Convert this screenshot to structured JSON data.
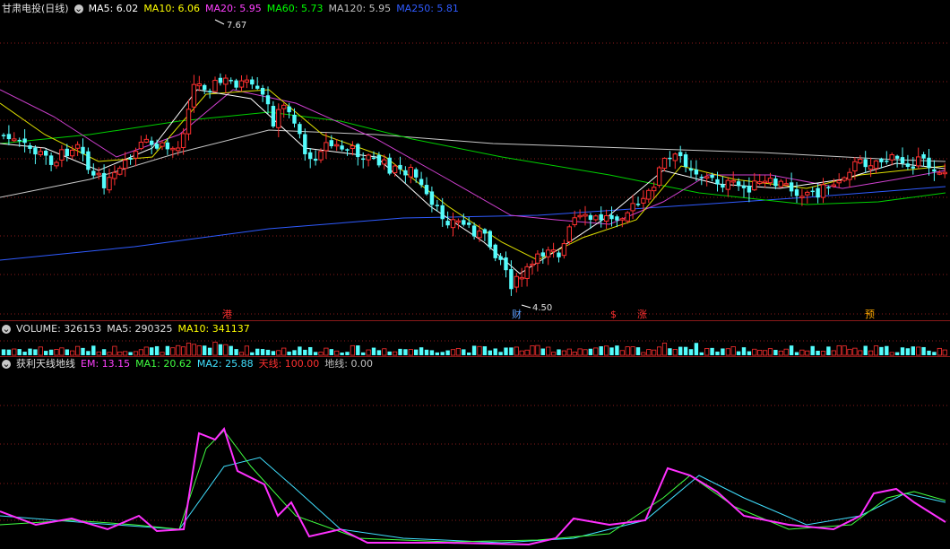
{
  "main_header": {
    "stock": "甘肃电投(日线)",
    "indicators": [
      {
        "label": "MA5: 6.02",
        "color": "#ffffff"
      },
      {
        "label": "MA10: 6.06",
        "color": "#ffff00"
      },
      {
        "label": "MA20: 5.95",
        "color": "#ff40ff"
      },
      {
        "label": "MA60: 5.73",
        "color": "#00ff00"
      },
      {
        "label": "MA120: 5.95",
        "color": "#c0c0c0"
      },
      {
        "label": "MA250: 5.81",
        "color": "#2f5bff"
      }
    ]
  },
  "price_marks": {
    "high": "7.67",
    "low": "4.50"
  },
  "event_marks": [
    {
      "label": "港",
      "color": "#ff3030"
    },
    {
      "label": "财",
      "color": "#5aa0ff"
    },
    {
      "label": "$",
      "color": "#ff3030"
    },
    {
      "label": "涨",
      "color": "#ff3030"
    },
    {
      "label": "预",
      "color": "#ffaa00"
    }
  ],
  "volume_header": [
    {
      "label": "VOLUME: 326153",
      "color": "#e0e0e0"
    },
    {
      "label": "MA5: 290325",
      "color": "#e0e0e0"
    },
    {
      "label": "MA10: 341137",
      "color": "#ffff00"
    }
  ],
  "ind_header": {
    "name": "获利天线地线",
    "items": [
      {
        "label": "EM: 13.15",
        "color": "#ff40ff"
      },
      {
        "label": "MA1: 20.62",
        "color": "#40ff40"
      },
      {
        "label": "MA2: 25.88",
        "color": "#40e0ff"
      },
      {
        "label": "天线: 100.00",
        "color": "#ff3030"
      },
      {
        "label": "地线: 0.00",
        "color": "#c0c0c0"
      }
    ]
  },
  "colors": {
    "up": "#ff3030",
    "down": "#54fcfc",
    "grid": "#8a1a1a"
  }
}
